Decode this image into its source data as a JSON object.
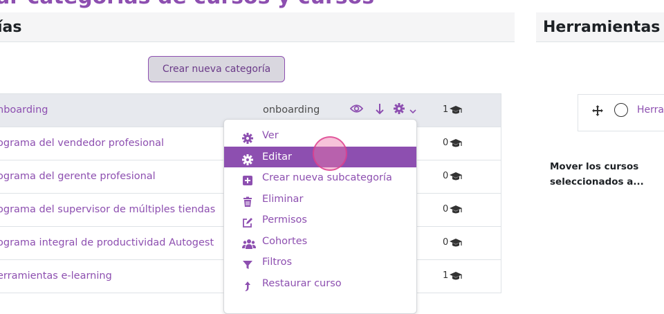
{
  "page": {
    "title": "ar categorías de cursos y cursos"
  },
  "left_panel": {
    "heading": "ías",
    "create_button": "Crear nueva categoría"
  },
  "categories": [
    {
      "name": "nboarding",
      "idnumber": "onboarding",
      "count": "1"
    },
    {
      "name": "ograma del vendedor profesional",
      "idnumber": "",
      "count": "0"
    },
    {
      "name": "ograma del gerente profesional",
      "idnumber": "",
      "count": "0"
    },
    {
      "name": "ograma del supervisor de múltiples tiendas",
      "idnumber": "",
      "count": "0"
    },
    {
      "name": "ograma integral de productividad Autogest",
      "idnumber": "",
      "count": "0"
    },
    {
      "name": "erramientas e-learning",
      "idnumber": "",
      "count": "1"
    }
  ],
  "context_menu": {
    "items": [
      {
        "label": "Ver",
        "icon": "gear-icon"
      },
      {
        "label": "Editar",
        "icon": "gear-icon",
        "active": true
      },
      {
        "label": "Crear nueva subcategoría",
        "icon": "plus-square-icon"
      },
      {
        "label": "Eliminar",
        "icon": "trash-icon"
      },
      {
        "label": "Permisos",
        "icon": "edit-icon"
      },
      {
        "label": "Cohortes",
        "icon": "users-icon"
      },
      {
        "label": "Filtros",
        "icon": "filter-icon"
      },
      {
        "label": "Restaurar curso",
        "icon": "restore-icon"
      }
    ]
  },
  "right_panel": {
    "heading": "Herramientas",
    "tool_label": "Herra",
    "move_label": "Mover los cursos seleccionados a..."
  },
  "colors": {
    "accent": "#8d4fb0",
    "header_bg": "#f5f5f6",
    "row_highlight": "#e7e9ee"
  }
}
